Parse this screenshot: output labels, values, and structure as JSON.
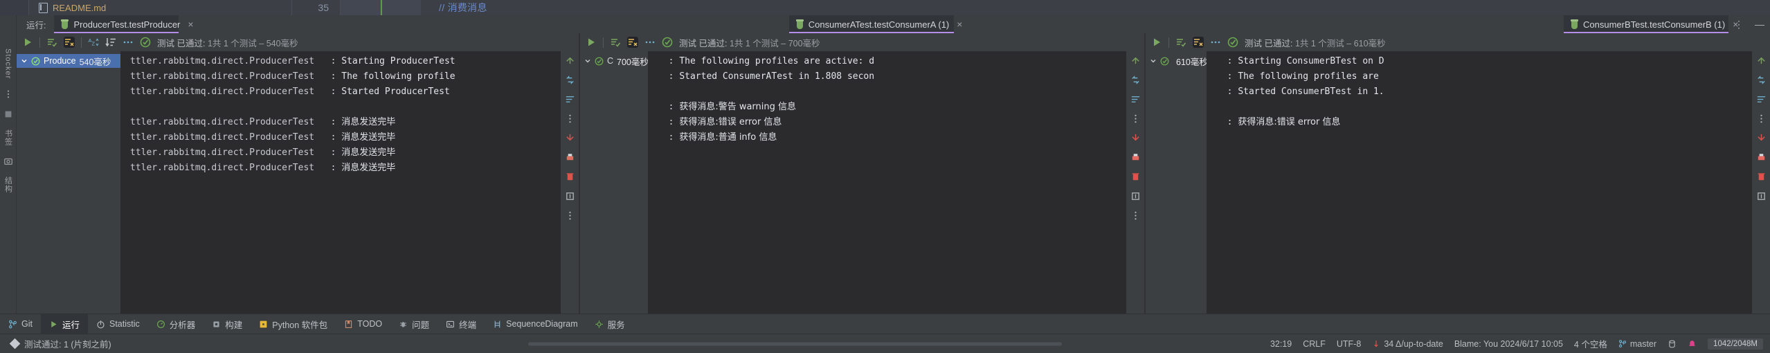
{
  "editor": {
    "file_tab": {
      "name": "README.md",
      "icon": "markdown-file-icon"
    },
    "line_number": "35",
    "code_comment": "// 消费消息"
  },
  "left_rail": {
    "items": [
      {
        "label": "Stocker",
        "name": "stocker"
      },
      {
        "label": "书签",
        "name": "bookmarks"
      },
      {
        "label": "结构",
        "name": "structure"
      }
    ]
  },
  "run_window": {
    "label": "运行:",
    "tabs": [
      {
        "title": "ProducerTest.testProducer",
        "close": "×",
        "active": true
      },
      {
        "title": "ConsumerATest.testConsumerA (1)",
        "close": "×",
        "active": true
      },
      {
        "title": "ConsumerBTest.testConsumerB (1)",
        "close": "×",
        "active": true
      }
    ],
    "window_more": "⋮",
    "window_minimize": "—"
  },
  "panes": [
    {
      "name": "producer",
      "toolbar": {
        "rerun": "run-icon",
        "status_prefix": "测试 已通过:",
        "status_counts": "1共 1 个测试",
        "status_time": "– 540毫秒",
        "more": "…"
      },
      "tree": [
        {
          "label": "Produce",
          "duration": "540毫秒",
          "selected": true
        }
      ],
      "console": [
        {
          "logger": "ttler.rabbitmq.direct.ProducerTest",
          "sep": ":",
          "message": "Starting ProducerTest"
        },
        {
          "logger": "ttler.rabbitmq.direct.ProducerTest",
          "sep": ":",
          "message": "The following profile"
        },
        {
          "logger": "ttler.rabbitmq.direct.ProducerTest",
          "sep": ":",
          "message": "Started ProducerTest"
        },
        {
          "logger": "",
          "sep": "",
          "message": ""
        },
        {
          "logger": "ttler.rabbitmq.direct.ProducerTest",
          "sep": ":",
          "message": "消息发送完毕"
        },
        {
          "logger": "ttler.rabbitmq.direct.ProducerTest",
          "sep": ":",
          "message": "消息发送完毕"
        },
        {
          "logger": "ttler.rabbitmq.direct.ProducerTest",
          "sep": ":",
          "message": "消息发送完毕"
        },
        {
          "logger": "ttler.rabbitmq.direct.ProducerTest",
          "sep": ":",
          "message": "消息发送完毕"
        }
      ]
    },
    {
      "name": "consumer-a",
      "toolbar": {
        "status_prefix": "测试 已通过:",
        "status_counts": "1共 1 个测试",
        "status_time": "– 700毫秒",
        "more": "…"
      },
      "tree": [
        {
          "label": "C",
          "duration": "700毫秒",
          "selected": false
        }
      ],
      "console": [
        {
          "logger": "",
          "sep": ":",
          "message": "The following profiles are active: d"
        },
        {
          "logger": "",
          "sep": ":",
          "message": "Started ConsumerATest in 1.808 secon"
        },
        {
          "logger": "",
          "sep": "",
          "message": ""
        },
        {
          "logger": "",
          "sep": ":",
          "message": "获得消息:警告 warning 信息"
        },
        {
          "logger": "",
          "sep": ":",
          "message": "获得消息:错误 error 信息"
        },
        {
          "logger": "",
          "sep": ":",
          "message": "获得消息:普通 info 信息"
        }
      ]
    },
    {
      "name": "consumer-b",
      "toolbar": {
        "status_prefix": "测试 已通过:",
        "status_counts": "1共 1 个测试",
        "status_time": "– 610毫秒",
        "more": "…"
      },
      "tree": [
        {
          "label": "",
          "duration": "610毫秒",
          "selected": false
        }
      ],
      "console": [
        {
          "logger": "",
          "sep": ":",
          "message": "Starting ConsumerBTest on D"
        },
        {
          "logger": "",
          "sep": ":",
          "message": "The following profiles are"
        },
        {
          "logger": "",
          "sep": ":",
          "message": "Started ConsumerBTest in 1."
        },
        {
          "logger": "",
          "sep": "",
          "message": ""
        },
        {
          "logger": "",
          "sep": ":",
          "message": "获得消息:错误 error 信息"
        }
      ]
    }
  ],
  "bottom_tools": [
    {
      "label": "Git",
      "icon": "git-branch-icon",
      "active": false
    },
    {
      "label": "运行",
      "icon": "run-icon",
      "active": true
    },
    {
      "label": "Statistic",
      "icon": "statistic-icon",
      "active": false
    },
    {
      "label": "分析器",
      "icon": "profiler-icon",
      "active": false
    },
    {
      "label": "构建",
      "icon": "build-icon",
      "active": false
    },
    {
      "label": "Python 软件包",
      "icon": "python-packages-icon",
      "active": false
    },
    {
      "label": "TODO",
      "icon": "todo-icon",
      "active": false
    },
    {
      "label": "问题",
      "icon": "problems-icon",
      "active": false
    },
    {
      "label": "终端",
      "icon": "terminal-icon",
      "active": false
    },
    {
      "label": "SequenceDiagram",
      "icon": "sequence-diagram-icon",
      "active": false
    },
    {
      "label": "服务",
      "icon": "services-icon",
      "active": false
    }
  ],
  "status_bar": {
    "message": "测试通过: 1 (片刻之前)",
    "caret": "32:19",
    "line_sep": "CRLF",
    "encoding": "UTF-8",
    "vcs_sync": "34 Δ/up-to-date",
    "blame": "Blame: You 2024/6/17 10:05",
    "indent": "4 个空格",
    "branch": "master",
    "memory": "1042/2048M"
  },
  "colors": {
    "accent_tab_underline": "#b48ee8",
    "pass_green": "#6aa84f",
    "selection_blue": "#4b6eaf",
    "console_bg": "#2b2b2e",
    "panel_bg": "#3c3f41",
    "comment_blue": "#6a8aca"
  }
}
